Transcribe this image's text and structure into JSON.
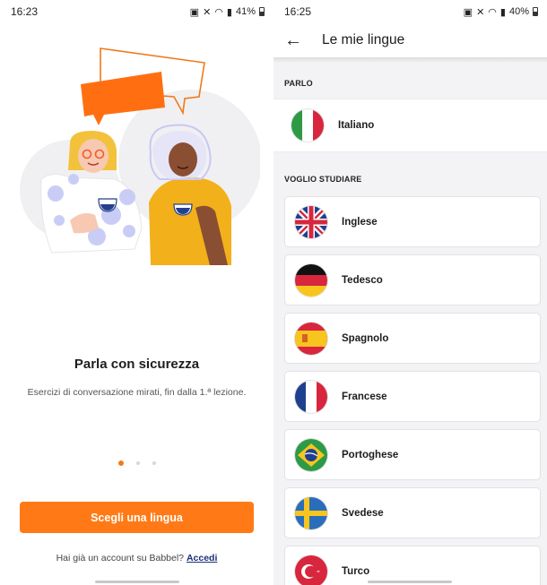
{
  "left_screen": {
    "status": {
      "time": "16:23",
      "battery": "41%"
    },
    "headline": "Parla con sicurezza",
    "subtext": "Esercizi di conversazione mirati, fin dalla 1.ª lezione.",
    "pagination": {
      "total": 3,
      "active": 1
    },
    "cta_label": "Scegli una lingua",
    "login_prompt": "Hai già un account su Babbel?",
    "login_link": "Accedi"
  },
  "right_screen": {
    "status": {
      "time": "16:25",
      "battery": "40%"
    },
    "title": "Le mie lingue",
    "speak_section": "PARLO",
    "speak_language": {
      "name": "Italiano",
      "flag": "italy-flag-icon"
    },
    "study_section": "VOGLIO STUDIARE",
    "languages": [
      {
        "name": "Inglese",
        "flag": "uk-flag-icon"
      },
      {
        "name": "Tedesco",
        "flag": "germany-flag-icon"
      },
      {
        "name": "Spagnolo",
        "flag": "spain-flag-icon"
      },
      {
        "name": "Francese",
        "flag": "france-flag-icon"
      },
      {
        "name": "Portoghese",
        "flag": "brazil-flag-icon"
      },
      {
        "name": "Svedese",
        "flag": "sweden-flag-icon"
      },
      {
        "name": "Turco",
        "flag": "turkey-flag-icon"
      }
    ]
  },
  "colors": {
    "accent": "#ff7a16",
    "link": "#1b2f78",
    "background_right": "#f3f3f5"
  }
}
